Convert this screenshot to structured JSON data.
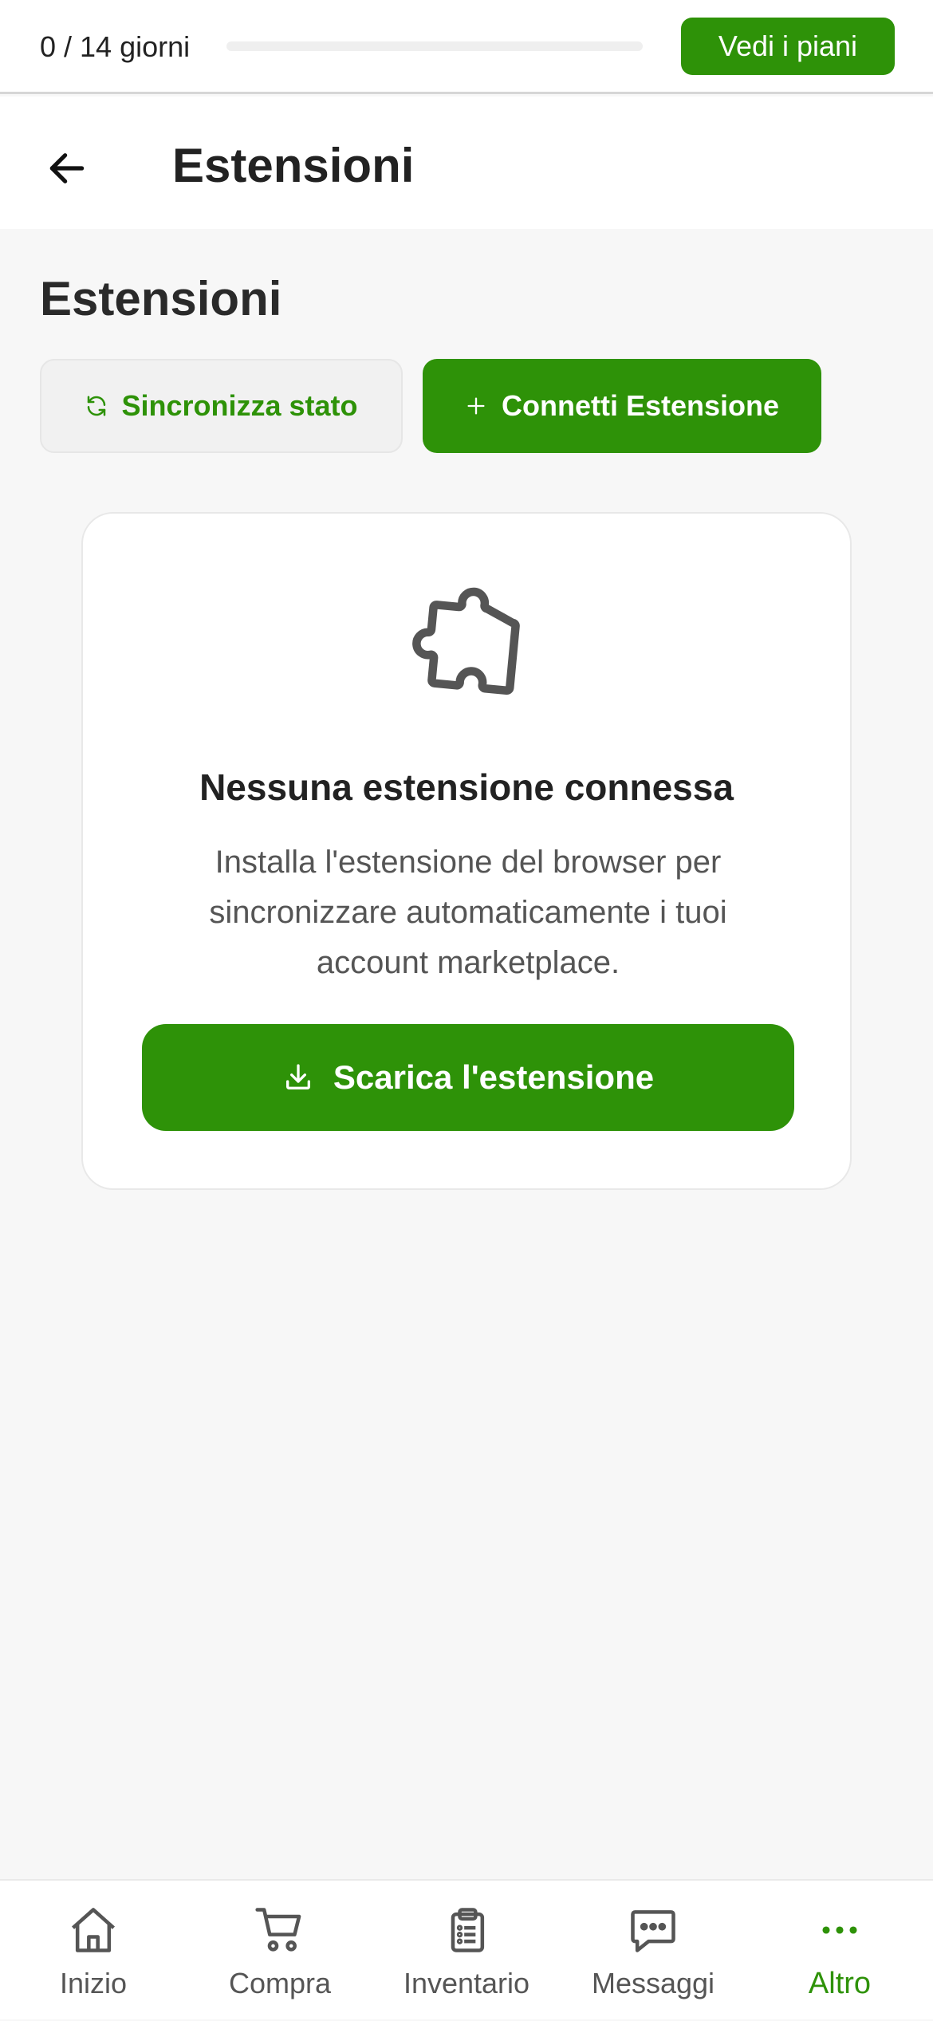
{
  "trial": {
    "progress_text": "0 / 14 giorni",
    "progress_fraction": 0,
    "plans_label": "Vedi i piani"
  },
  "header": {
    "title": "Estensioni"
  },
  "main": {
    "title": "Estensioni",
    "sync_label": "Sincronizza stato",
    "connect_label": "Connetti Estensione"
  },
  "empty_state": {
    "title": "Nessuna estensione connessa",
    "description": "Installa l'estensione del browser per sincronizzare automaticamente i tuoi account marketplace.",
    "download_label": "Scarica l'estensione"
  },
  "bottom_nav": {
    "items": [
      {
        "label": "Inizio",
        "icon": "home-icon"
      },
      {
        "label": "Compra",
        "icon": "cart-icon"
      },
      {
        "label": "Inventario",
        "icon": "clipboard-icon"
      },
      {
        "label": "Messaggi",
        "icon": "chat-icon"
      },
      {
        "label": "Altro",
        "icon": "more-dots-icon",
        "active": true
      }
    ]
  },
  "colors": {
    "accent": "#2e9208",
    "text": "#222222",
    "muted": "#555555",
    "background": "#f7f7f7"
  }
}
